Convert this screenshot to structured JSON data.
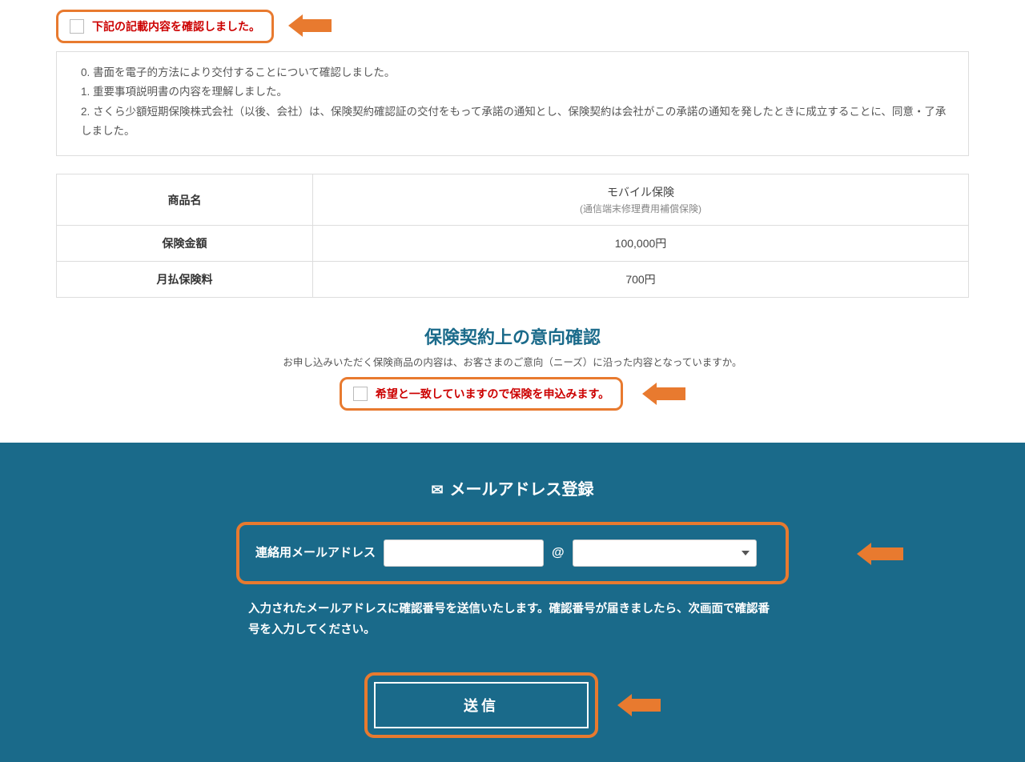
{
  "confirm_checkbox": {
    "label": "下記の記載内容を確認しました。"
  },
  "confirm_list": {
    "item0": "0. 書面を電子的方法により交付することについて確認しました。",
    "item1": "1. 重要事項説明書の内容を理解しました。",
    "item2": "2. さくら少額短期保険株式会社（以後、会社）は、保険契約確認証の交付をもって承諾の通知とし、保険契約は会社がこの承諾の通知を発したときに成立することに、同意・了承しました。"
  },
  "table": {
    "row1_label": "商品名",
    "row1_value": "モバイル保険",
    "row1_sub": "(通信端末修理費用補償保険)",
    "row2_label": "保険金額",
    "row2_value": "100,000円",
    "row3_label": "月払保険料",
    "row3_value": "700円"
  },
  "intent": {
    "title": "保険契約上の意向確認",
    "desc": "お申し込みいただく保険商品の内容は、お客さまのご意向（ニーズ）に沿った内容となっていますか。",
    "checkbox_label": "希望と一致していますので保険を申込みます。"
  },
  "email": {
    "title": "メールアドレス登録",
    "label": "連絡用メールアドレス",
    "at": "@",
    "note": "入力されたメールアドレスに確認番号を送信いたします。確認番号が届きましたら、次画面で確認番号を入力してください。"
  },
  "submit": {
    "label": "送信"
  }
}
